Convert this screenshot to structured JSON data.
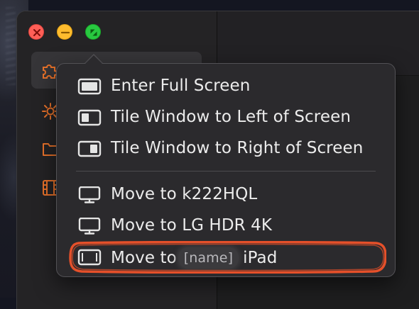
{
  "window_controls": {
    "close_color": "#ff5f57",
    "minimize_color": "#febc2e",
    "zoom_color": "#28c840"
  },
  "sidebar": {
    "items": [
      {
        "icon": "puzzle-icon",
        "selected": true
      },
      {
        "icon": "sun-icon",
        "selected": false
      },
      {
        "icon": "folder-icon",
        "selected": false
      },
      {
        "icon": "film-icon",
        "selected": false
      }
    ],
    "icon_color": "#e8722a"
  },
  "menu": {
    "window_items": [
      {
        "label": "Enter Full Screen",
        "icon": "fullscreen-window-icon"
      },
      {
        "label": "Tile Window to Left of Screen",
        "icon": "tile-left-icon"
      },
      {
        "label": "Tile Window to Right of Screen",
        "icon": "tile-right-icon"
      }
    ],
    "move_items": [
      {
        "label": "Move to k222HQL",
        "icon": "display-icon"
      },
      {
        "label": "Move to LG HDR 4K",
        "icon": "display-icon"
      }
    ],
    "ipad_item": {
      "prefix": "Move to",
      "redacted_name": "[name]",
      "suffix": "iPad",
      "icon": "ipad-icon"
    }
  },
  "annotation_color": "#e5502a"
}
